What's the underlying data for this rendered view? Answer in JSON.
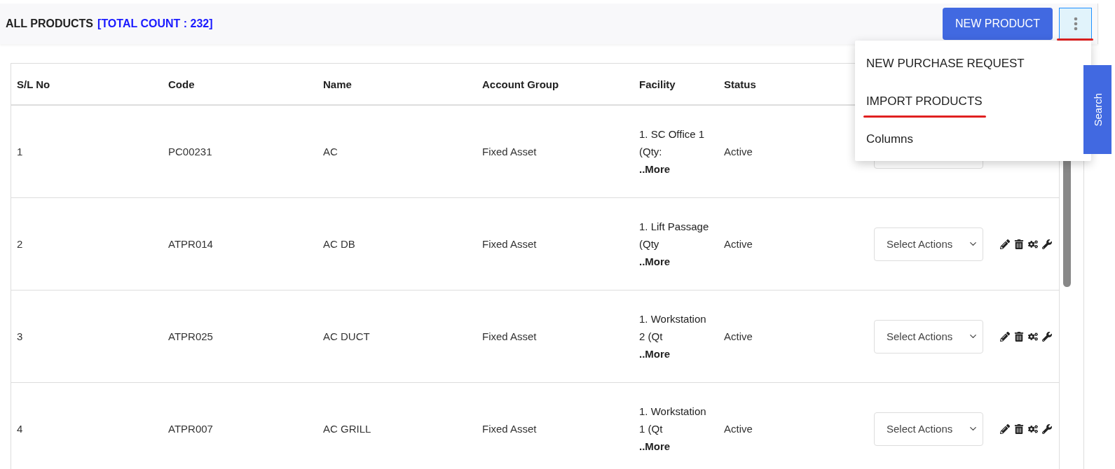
{
  "header": {
    "title": "ALL PRODUCTS",
    "count": "[TOTAL COUNT : 232]",
    "new_button": "NEW PRODUCT",
    "menu_button": {
      "expanded": true,
      "highlighted": true
    }
  },
  "menu": {
    "items": [
      {
        "label": "NEW PURCHASE REQUEST",
        "highlighted": false
      },
      {
        "label": "IMPORT PRODUCTS",
        "highlighted": true
      },
      {
        "label": "Columns",
        "highlighted": false
      }
    ]
  },
  "search_tab": "Search",
  "table": {
    "columns": [
      "S/L No",
      "Code",
      "Name",
      "Account Group",
      "Facility",
      "Status"
    ],
    "rows": [
      {
        "sl": "1",
        "code": "PC00231",
        "name": "AC",
        "group": "Fixed Asset",
        "facility": "1. SC Office 1 (Qty:",
        "more": "..More",
        "status": "Active"
      },
      {
        "sl": "2",
        "code": "ATPR014",
        "name": "AC DB",
        "group": "Fixed Asset",
        "facility": "1. Lift Passage (Qty",
        "more": "..More",
        "status": "Active",
        "action_select": "Select Actions"
      },
      {
        "sl": "3",
        "code": "ATPR025",
        "name": "AC DUCT",
        "group": "Fixed Asset",
        "facility": "1. Workstation 2 (Qt",
        "more": "..More",
        "status": "Active",
        "action_select": "Select Actions"
      },
      {
        "sl": "4",
        "code": "ATPR007",
        "name": "AC GRILL",
        "group": "Fixed Asset",
        "facility": "1. Workstation 1 (Qt",
        "more": "..More",
        "status": "Active",
        "action_select": "Select Actions"
      }
    ]
  }
}
